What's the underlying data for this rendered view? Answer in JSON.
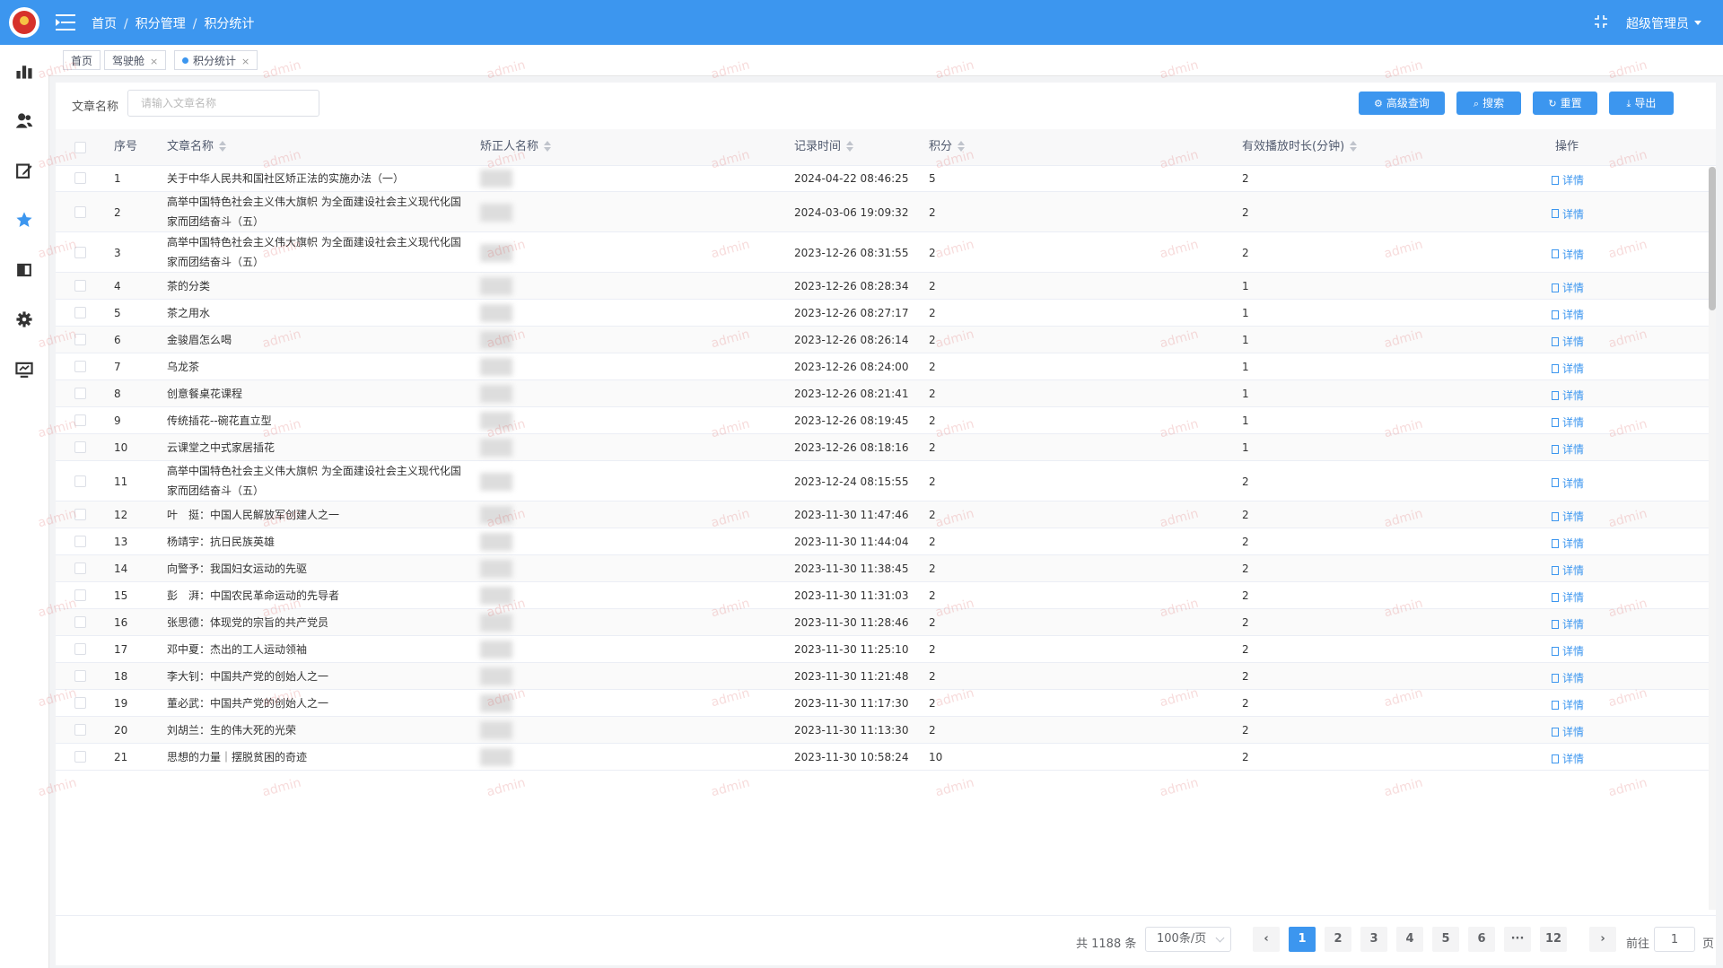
{
  "header": {
    "breadcrumb": [
      "首页",
      "积分管理",
      "积分统计"
    ],
    "user": "超级管理员"
  },
  "sidebar": {
    "icons": [
      "chart-icon",
      "users-icon",
      "edit-icon",
      "star-icon",
      "book-icon",
      "gear-icon",
      "monitor-icon"
    ],
    "active": "star-icon"
  },
  "tags": [
    {
      "label": "首页",
      "closable": false,
      "active": false
    },
    {
      "label": "驾驶舱",
      "closable": true,
      "active": false
    },
    {
      "label": "积分统计",
      "closable": true,
      "active": true
    }
  ],
  "filter": {
    "label": "文章名称",
    "placeholder": "请输入文章名称",
    "buttons": {
      "advanced": "高级查询",
      "search": "搜索",
      "reset": "重置",
      "export": "导出"
    }
  },
  "table": {
    "columns": {
      "index": "序号",
      "title": "文章名称",
      "person": "矫正人名称",
      "time": "记录时间",
      "score": "积分",
      "duration": "有效播放时长(分钟)",
      "action": "操作"
    },
    "detail_label": "详情",
    "rows": [
      {
        "index": "1",
        "title": "关于中华人民共和国社区矫正法的实施办法（一）",
        "time": "2024-04-22 08:46:25",
        "score": "5",
        "duration": "2"
      },
      {
        "index": "2",
        "title": "高举中国特色社会主义伟大旗帜 为全面建设社会主义现代化国家而团结奋斗（五）",
        "time": "2024-03-06 19:09:32",
        "score": "2",
        "duration": "2"
      },
      {
        "index": "3",
        "title": "高举中国特色社会主义伟大旗帜 为全面建设社会主义现代化国家而团结奋斗（五）",
        "time": "2023-12-26 08:31:55",
        "score": "2",
        "duration": "2"
      },
      {
        "index": "4",
        "title": "茶的分类",
        "time": "2023-12-26 08:28:34",
        "score": "2",
        "duration": "1"
      },
      {
        "index": "5",
        "title": "茶之用水",
        "time": "2023-12-26 08:27:17",
        "score": "2",
        "duration": "1"
      },
      {
        "index": "6",
        "title": "金骏眉怎么喝",
        "time": "2023-12-26 08:26:14",
        "score": "2",
        "duration": "1"
      },
      {
        "index": "7",
        "title": "乌龙茶",
        "time": "2023-12-26 08:24:00",
        "score": "2",
        "duration": "1"
      },
      {
        "index": "8",
        "title": "创意餐桌花课程",
        "time": "2023-12-26 08:21:41",
        "score": "2",
        "duration": "1"
      },
      {
        "index": "9",
        "title": "传统插花--碗花直立型",
        "time": "2023-12-26 08:19:45",
        "score": "2",
        "duration": "1"
      },
      {
        "index": "10",
        "title": "云课堂之中式家居插花",
        "time": "2023-12-26 08:18:16",
        "score": "2",
        "duration": "1"
      },
      {
        "index": "11",
        "title": "高举中国特色社会主义伟大旗帜 为全面建设社会主义现代化国家而团结奋斗（五）",
        "time": "2023-12-24 08:15:55",
        "score": "2",
        "duration": "2"
      },
      {
        "index": "12",
        "title": "叶　挺：中国人民解放军创建人之一",
        "time": "2023-11-30 11:47:46",
        "score": "2",
        "duration": "2"
      },
      {
        "index": "13",
        "title": "杨靖宇：抗日民族英雄",
        "time": "2023-11-30 11:44:04",
        "score": "2",
        "duration": "2"
      },
      {
        "index": "14",
        "title": "向警予：我国妇女运动的先驱",
        "time": "2023-11-30 11:38:45",
        "score": "2",
        "duration": "2"
      },
      {
        "index": "15",
        "title": "彭　湃：中国农民革命运动的先导者",
        "time": "2023-11-30 11:31:03",
        "score": "2",
        "duration": "2"
      },
      {
        "index": "16",
        "title": "张思德：体现党的宗旨的共产党员",
        "time": "2023-11-30 11:28:46",
        "score": "2",
        "duration": "2"
      },
      {
        "index": "17",
        "title": "邓中夏：杰出的工人运动领袖",
        "time": "2023-11-30 11:25:10",
        "score": "2",
        "duration": "2"
      },
      {
        "index": "18",
        "title": "李大钊：中国共产党的创始人之一",
        "time": "2023-11-30 11:21:48",
        "score": "2",
        "duration": "2"
      },
      {
        "index": "19",
        "title": "董必武：中国共产党的创始人之一",
        "time": "2023-11-30 11:17:30",
        "score": "2",
        "duration": "2"
      },
      {
        "index": "20",
        "title": "刘胡兰：生的伟大死的光荣",
        "time": "2023-11-30 11:13:30",
        "score": "2",
        "duration": "2"
      },
      {
        "index": "21",
        "title": "思想的力量｜摆脱贫困的奇迹",
        "time": "2023-11-30 10:58:24",
        "score": "10",
        "duration": "2"
      }
    ]
  },
  "pagination": {
    "total": "共 1188 条",
    "page_size": "100条/页",
    "pages": [
      "1",
      "2",
      "3",
      "4",
      "5",
      "6",
      "···",
      "12"
    ],
    "current": "1",
    "goto_label": "前往",
    "goto_value": "1",
    "goto_unit": "页"
  },
  "watermark": "admin",
  "colors": {
    "primary": "#3c96ef",
    "header_bg": "#3c96ef"
  }
}
